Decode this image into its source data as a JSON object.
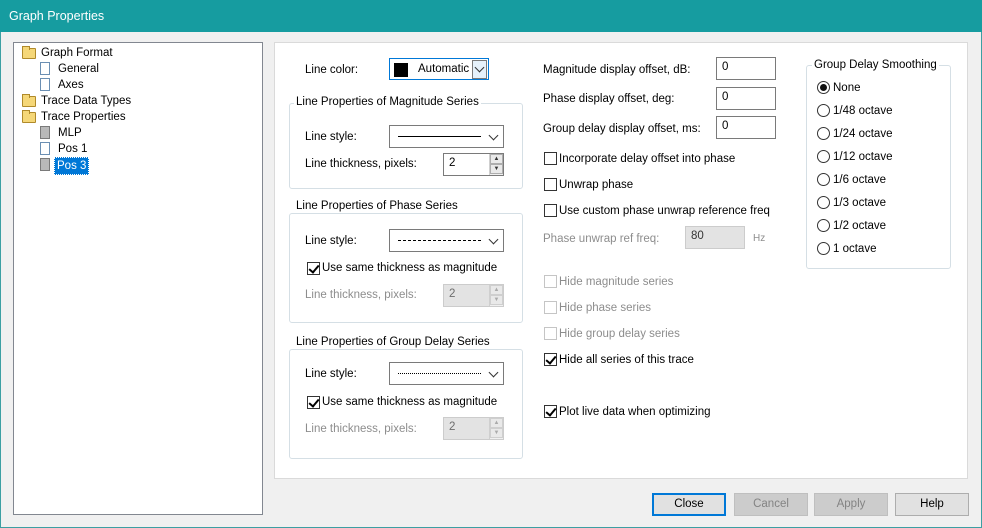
{
  "window": {
    "title": "Graph Properties"
  },
  "tree": {
    "graph_format": "Graph Format",
    "general": "General",
    "axes": "Axes",
    "trace_data_types": "Trace Data Types",
    "trace_properties": "Trace Properties",
    "mlp": "MLP",
    "pos1": "Pos 1",
    "pos3": "Pos 3"
  },
  "line_color": {
    "label": "Line color:",
    "value": "Automatic",
    "swatch": "#000000"
  },
  "magnitude_group": {
    "title": "Line Properties of Magnitude Series",
    "style_label": "Line style:",
    "thickness_label": "Line thickness, pixels:",
    "thickness_value": "2"
  },
  "phase_group": {
    "title": "Line Properties of Phase Series",
    "style_label": "Line style:",
    "same_thickness_label": "Use same thickness as magnitude",
    "thickness_label": "Line thickness, pixels:",
    "thickness_value": "2"
  },
  "delay_group": {
    "title": "Line Properties of Group Delay Series",
    "style_label": "Line style:",
    "same_thickness_label": "Use same thickness as magnitude",
    "thickness_label": "Line thickness, pixels:",
    "thickness_value": "2"
  },
  "offsets": {
    "magnitude_label": "Magnitude display offset, dB:",
    "magnitude_value": "0",
    "phase_label": "Phase display offset, deg:",
    "phase_value": "0",
    "delay_label": "Group delay display offset, ms:",
    "delay_value": "0"
  },
  "options": {
    "incorporate_delay": "Incorporate delay offset into phase",
    "unwrap_phase": "Unwrap phase",
    "custom_unwrap": "Use custom phase unwrap reference freq",
    "unwrap_ref_label": "Phase unwrap ref freq:",
    "unwrap_ref_value": "80",
    "unwrap_ref_unit": "Hz",
    "hide_magnitude": "Hide magnitude series",
    "hide_phase": "Hide phase series",
    "hide_delay": "Hide group delay series",
    "hide_all": "Hide all series of this trace",
    "plot_live": "Plot live data when optimizing"
  },
  "smoothing": {
    "title": "Group Delay Smoothing",
    "options": [
      "None",
      "1/48 octave",
      "1/24 octave",
      "1/12 octave",
      "1/6 octave",
      "1/3 octave",
      "1/2 octave",
      "1 octave"
    ],
    "selected": "None"
  },
  "buttons": {
    "close": "Close",
    "cancel": "Cancel",
    "apply": "Apply",
    "help": "Help"
  },
  "colors": {
    "titlebar": "#169ca0",
    "selection": "#0078d7"
  }
}
